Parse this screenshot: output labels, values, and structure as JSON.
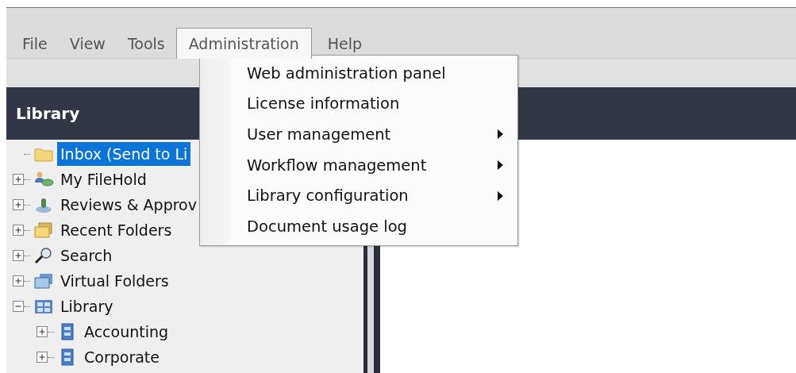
{
  "menu_bar": [
    {
      "label": "File",
      "selected": false
    },
    {
      "label": "View",
      "selected": false
    },
    {
      "label": "Tools",
      "selected": false
    },
    {
      "label": "Administration",
      "selected": true
    },
    {
      "label": "Help",
      "selected": false
    }
  ],
  "library_panel": {
    "title": "Library",
    "tree": [
      {
        "label": "Inbox (Send to Li",
        "kind": "folder",
        "selected": true
      },
      {
        "label": "My FileHold",
        "kind": "user",
        "selected": false,
        "expanded": false
      },
      {
        "label": "Reviews & Approv",
        "kind": "review",
        "selected": false,
        "expanded": false
      },
      {
        "label": "Recent Folders",
        "kind": "recent",
        "selected": false,
        "expanded": false
      },
      {
        "label": "Search",
        "kind": "search",
        "selected": false,
        "expanded": false
      },
      {
        "label": "Virtual Folders",
        "kind": "virtual",
        "selected": false,
        "expanded": false
      },
      {
        "label": "Library",
        "kind": "library",
        "selected": false,
        "expanded": true,
        "children": [
          {
            "label": "Accounting",
            "kind": "cabinet",
            "selected": false,
            "expanded": false
          },
          {
            "label": "Corporate",
            "kind": "cabinet",
            "selected": false,
            "expanded": false
          }
        ]
      }
    ]
  },
  "dropdown_menu": {
    "items": [
      {
        "label": "Web administration panel",
        "submenu": false
      },
      {
        "label": "License information",
        "submenu": false
      },
      {
        "label": "User management",
        "submenu": true
      },
      {
        "label": "Workflow management",
        "submenu": true
      },
      {
        "label": "Library configuration",
        "submenu": true
      },
      {
        "label": "Document usage log",
        "submenu": false
      }
    ]
  }
}
